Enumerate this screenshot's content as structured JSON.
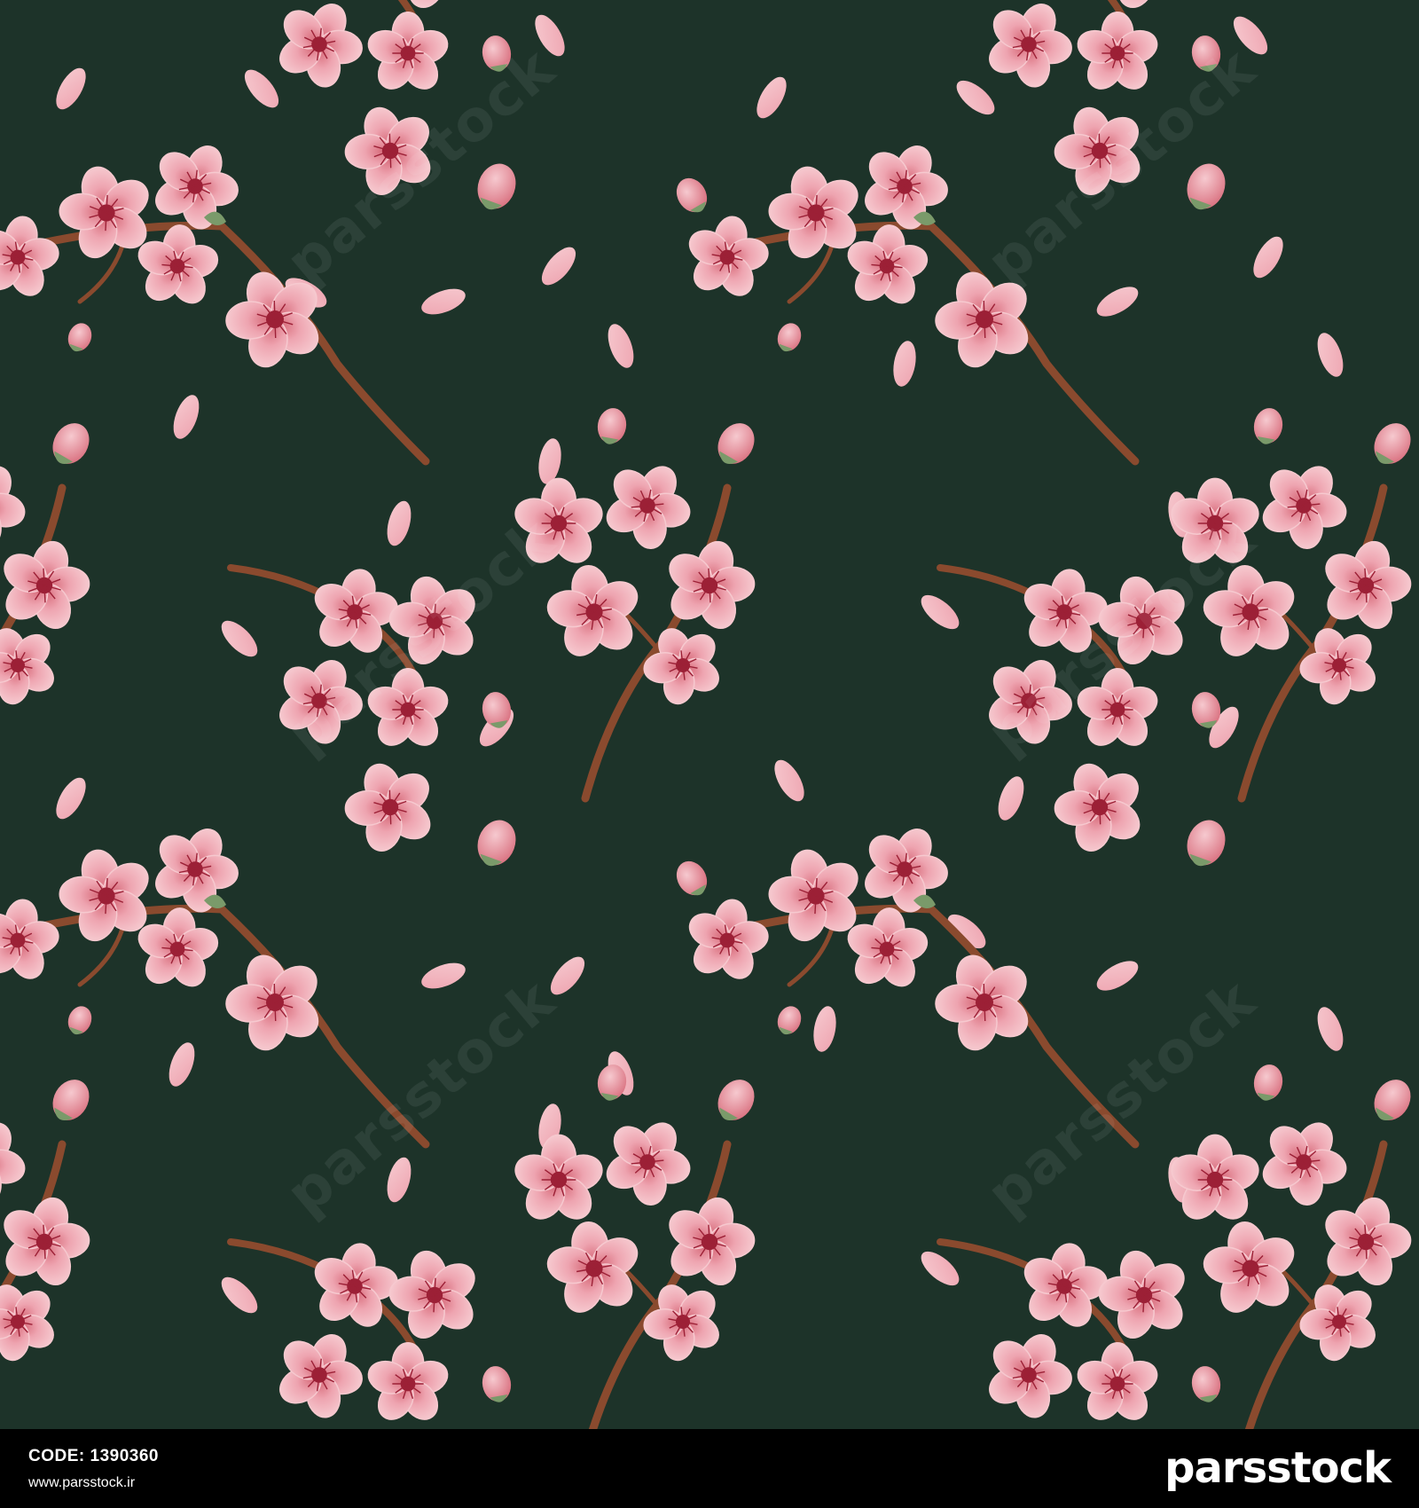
{
  "image": {
    "subject": "seamless watercolor pattern of pink cherry blossom branches and falling petals",
    "colors": {
      "background": "#1d3329",
      "petal_light": "#f6c9cf",
      "petal_mid": "#eea4b0",
      "petal_dark": "#d9707f",
      "flower_center": "#9c2036",
      "branch": "#8a4a2e",
      "leaf": "#7a9a6a",
      "footer_background": "#000000",
      "footer_text": "#ffffff"
    }
  },
  "watermark": {
    "text": "parsstock"
  },
  "footer": {
    "code_label": "CODE:",
    "code_value": "1390360",
    "site_url": "www.parsstock.ir",
    "brand_name": "parsstock"
  }
}
